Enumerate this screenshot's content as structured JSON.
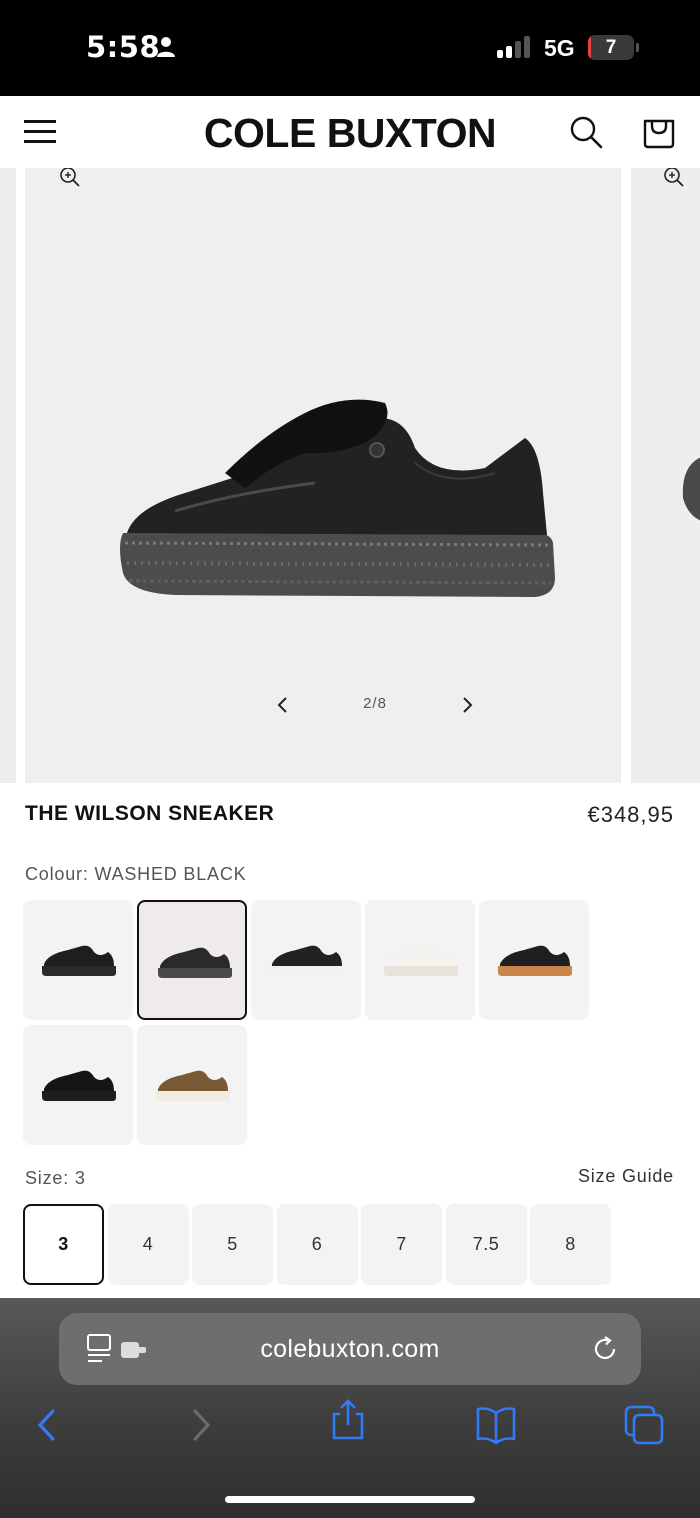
{
  "status_bar": {
    "time": "5:58",
    "network": "5G",
    "battery_level": "7",
    "battery_fraction": 0.07,
    "signal_bars": 2,
    "icons": [
      "person-icon",
      "signal-icon",
      "battery-icon"
    ]
  },
  "header": {
    "logo": "COLE BUXTON",
    "icons": [
      "menu-icon",
      "search-icon",
      "cart-icon"
    ]
  },
  "gallery": {
    "counter": "2/8",
    "icons": [
      "zoom-icon",
      "chevron-left-icon",
      "chevron-right-icon"
    ]
  },
  "product": {
    "title": "THE WILSON SNEAKER",
    "price": "€348,95",
    "colour_label": "Colour:",
    "colour_value": "WASHED BLACK",
    "swatches": [
      {
        "name": "black-dark",
        "selected": false,
        "upper": "#1e1e1e",
        "sole": "#2a2a2a"
      },
      {
        "name": "washed-black",
        "selected": true,
        "upper": "#2a2a2a",
        "sole": "#4a4a4a"
      },
      {
        "name": "black-white",
        "selected": false,
        "upper": "#222222",
        "sole": "#f2f2f0"
      },
      {
        "name": "off-white",
        "selected": false,
        "upper": "#f4f2ee",
        "sole": "#e8e4dc"
      },
      {
        "name": "black-gum",
        "selected": false,
        "upper": "#1f1f1f",
        "sole": "#c8864a"
      },
      {
        "name": "black-black",
        "selected": false,
        "upper": "#151515",
        "sole": "#1e1e1e"
      },
      {
        "name": "leopard",
        "selected": false,
        "upper": "#7a5a35",
        "sole": "#f0ece4"
      }
    ],
    "size_label": "Size:",
    "size_value": "3",
    "size_guide": "Size Guide",
    "sizes": [
      "3",
      "4",
      "5",
      "6",
      "7",
      "7.5",
      "8"
    ],
    "selected_size": "3"
  },
  "browser": {
    "url": "colebuxton.com",
    "icons": [
      "reader-icon",
      "extension-icon",
      "reload-icon",
      "back-icon",
      "forward-icon",
      "share-icon",
      "bookmarks-icon",
      "tabs-icon"
    ],
    "accent": "#2f7cf6"
  }
}
